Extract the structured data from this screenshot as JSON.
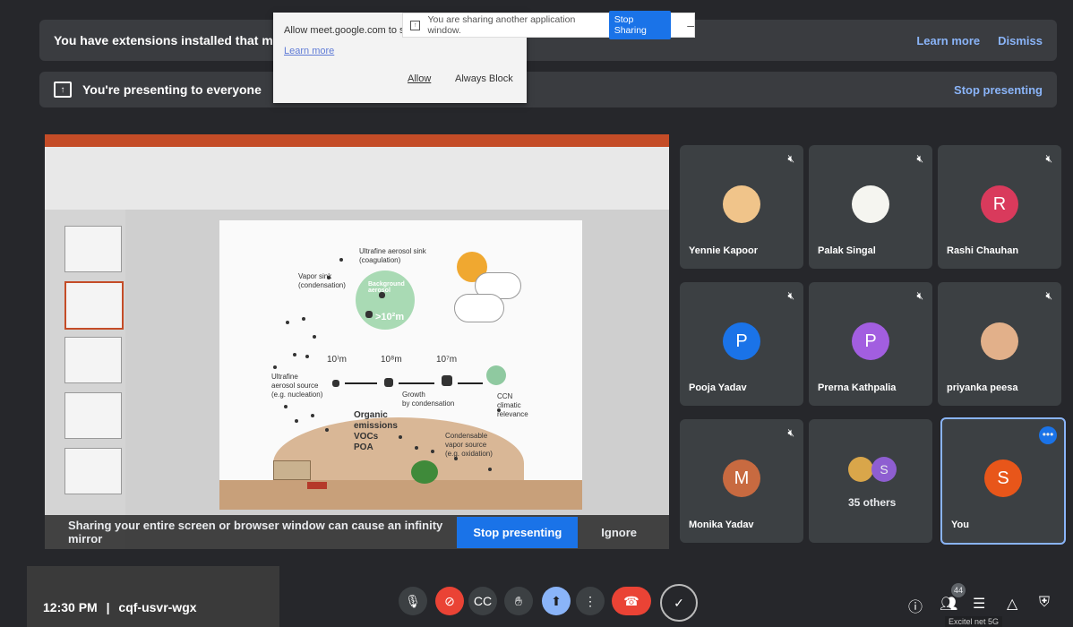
{
  "banners": {
    "extensions_text": "You have extensions installed that may affect the",
    "learn_more": "Learn more",
    "dismiss": "Dismiss",
    "presenting_text": "You're presenting to everyone",
    "stop_presenting": "Stop presenting"
  },
  "popup": {
    "message": "Allow meet.google.com to send",
    "learn_more": "Learn more",
    "allow": "Allow",
    "always_block": "Always Block"
  },
  "share_bar": {
    "text": "You are sharing another application window.",
    "stop_sharing": "Stop Sharing",
    "minimize": "–"
  },
  "slide": {
    "ultrafine_sink": "Ultrafine aerosol sink",
    "coagulation": "(coagulation)",
    "vapor_sink": "Vapor sink",
    "condensation_paren": "(condensation)",
    "background_aerosol": "Background aerosol",
    "size_big": ">10²m",
    "size_a": "10⁾m",
    "size_b": "10⁸m",
    "size_c": "10⁷m",
    "ultrafine_source": "Ultrafine",
    "aerosol_source": "aerosol source",
    "nucleation": "(e.g. nucleation)",
    "growth": "Growth",
    "by_condensation": "by condensation",
    "ccn": "CCN",
    "climatic": "climatic",
    "relevance": "relevance",
    "organic": "Organic",
    "emissions": "emissions",
    "vocs": "VOCs",
    "poa": "POA",
    "condensable": "Condensable",
    "vapor_source": "vapor source",
    "oxidation": "(e.g. oxidation)"
  },
  "infinity_bar": {
    "text": "Sharing your entire screen or browser window can cause an infinity mirror",
    "stop_presenting": "Stop presenting",
    "ignore": "Ignore"
  },
  "participants": [
    {
      "name": "Yennie Kapoor",
      "initial": "",
      "color": "#f0c48a"
    },
    {
      "name": "Palak Singal",
      "initial": "",
      "color": "#f5f5f0"
    },
    {
      "name": "Rashi Chauhan",
      "initial": "R",
      "color": "#d93a5c"
    },
    {
      "name": "Pooja Yadav",
      "initial": "P",
      "color": "#1a73e8"
    },
    {
      "name": "Prerna Kathpalia",
      "initial": "P",
      "color": "#a25ee0"
    },
    {
      "name": "priyanka peesa",
      "initial": "",
      "color": "#e2b08a"
    },
    {
      "name": "Monika Yadav",
      "initial": "M",
      "color": "#c86a40"
    },
    {
      "name": "35 others",
      "initial": "S",
      "color": "#8e5ed1"
    },
    {
      "name": "You",
      "initial": "S",
      "color": "#e8561a"
    }
  ],
  "meeting": {
    "time": "12:30 PM",
    "separator": "|",
    "code": "cqf-usvr-wgx"
  },
  "people_count": "44",
  "tooltip": "Excitel net 5G"
}
